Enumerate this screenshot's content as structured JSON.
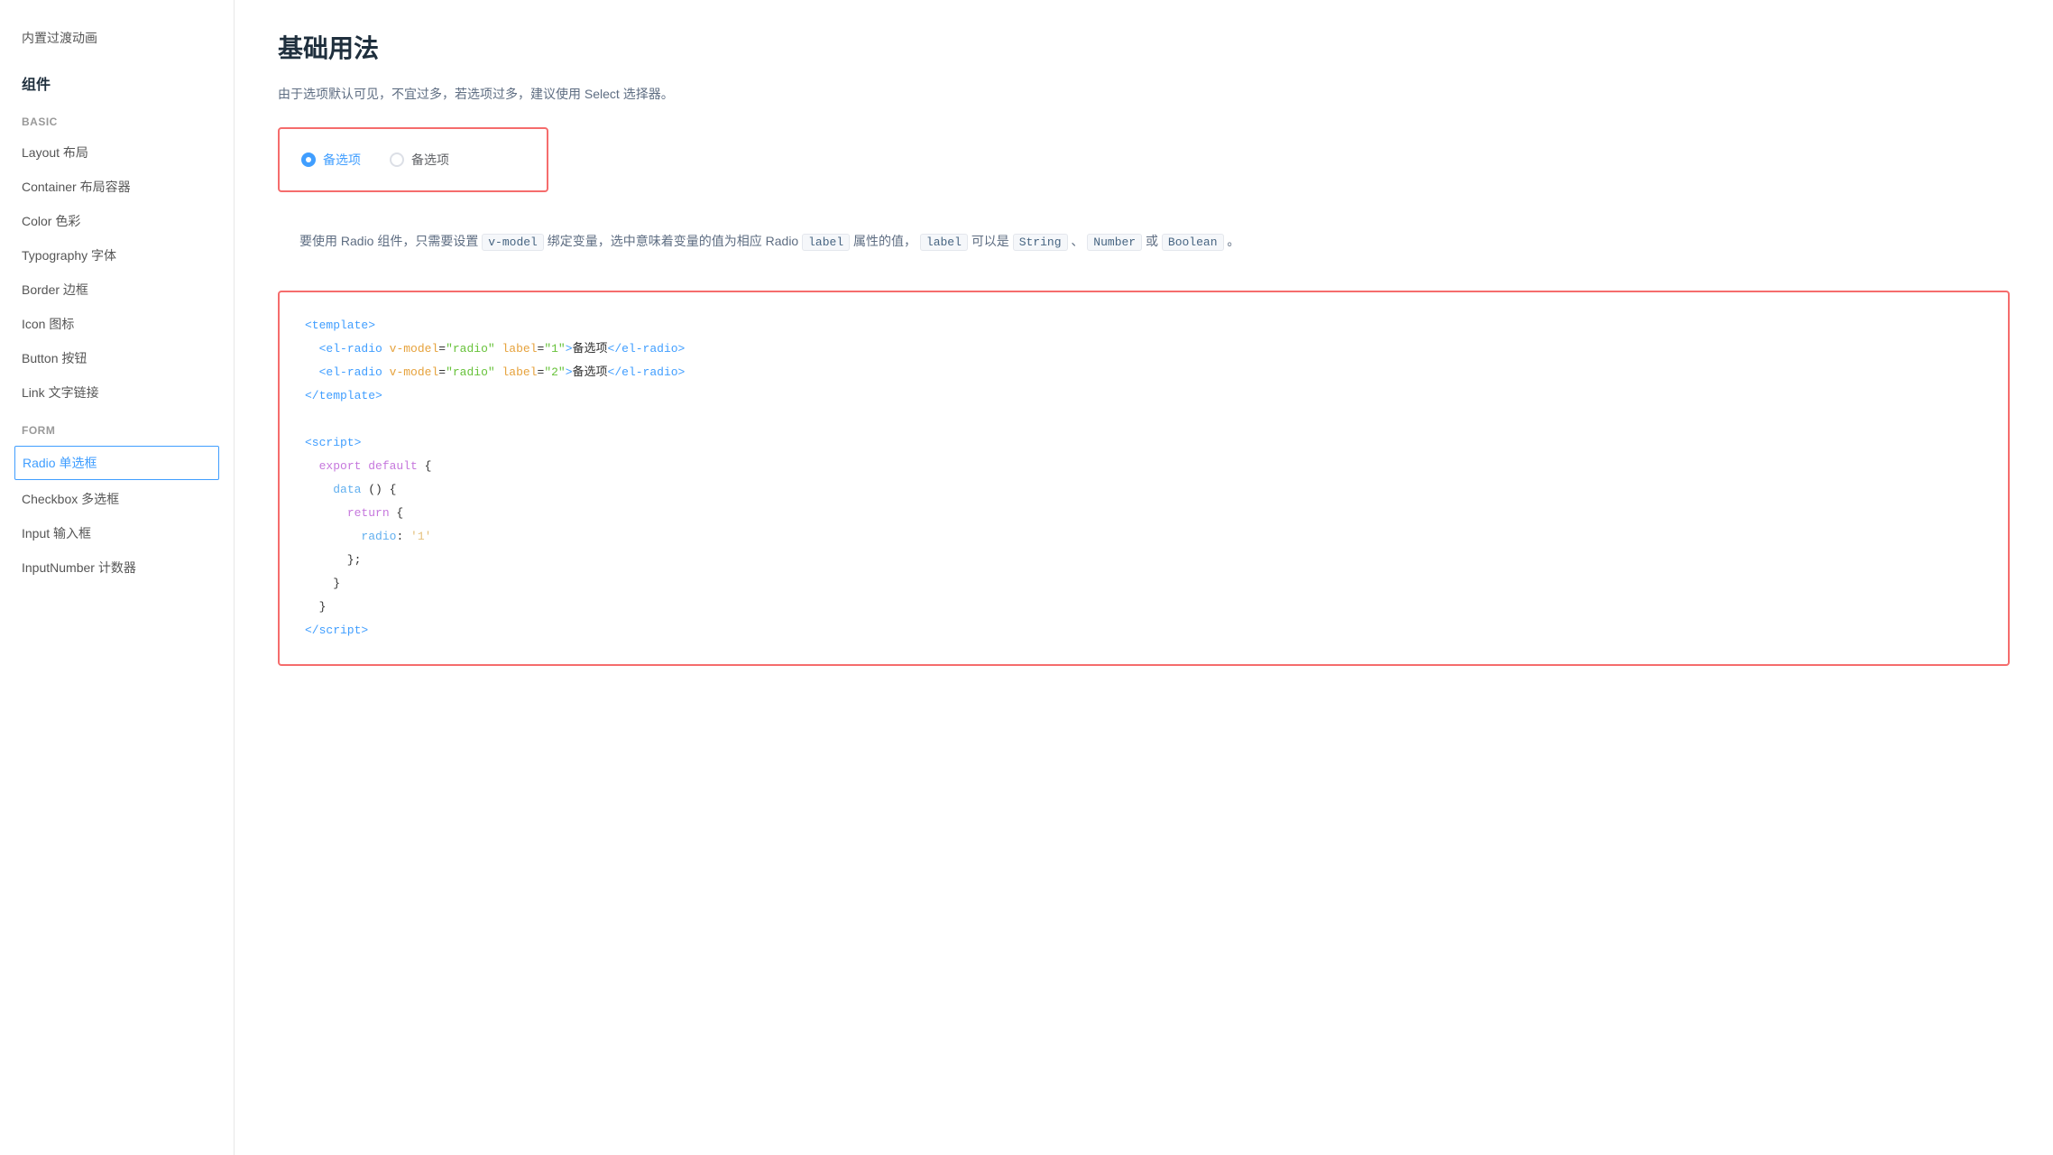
{
  "sidebar": {
    "top_items": [
      {
        "label": "内置过渡动画"
      }
    ],
    "section_basic": "Basic",
    "basic_items": [
      {
        "label": "Layout 布局"
      },
      {
        "label": "Container 布局容器"
      },
      {
        "label": "Color 色彩"
      },
      {
        "label": "Typography 字体"
      },
      {
        "label": "Border 边框"
      },
      {
        "label": "Icon 图标"
      },
      {
        "label": "Button 按钮"
      },
      {
        "label": "Link 文字链接"
      }
    ],
    "section_form": "Form",
    "form_items": [
      {
        "label": "Radio 单选框",
        "active": true
      },
      {
        "label": "Checkbox 多选框"
      },
      {
        "label": "Input 输入框"
      },
      {
        "label": "InputNumber 计数器"
      }
    ]
  },
  "main": {
    "title": "基础用法",
    "description": "由于选项默认可见，不宜过多，若选项过多，建议使用 Select 选择器。",
    "radio_options": [
      {
        "label": "备选项",
        "checked": true
      },
      {
        "label": "备选项",
        "checked": false
      }
    ],
    "desc_text_1": "要使用 Radio 组件，只需要设置",
    "desc_code_1": "v-model",
    "desc_text_2": "绑定变量，选中意味着变量的值为相应 Radio",
    "desc_code_2": "label",
    "desc_text_3": "属性的值，",
    "desc_code_3": "label",
    "desc_text_4": "可以是",
    "desc_code_4": "String",
    "desc_text_5": "、",
    "desc_code_5": "Number",
    "desc_text_6": "或",
    "desc_code_6": "Boolean",
    "desc_text_7": "。"
  }
}
